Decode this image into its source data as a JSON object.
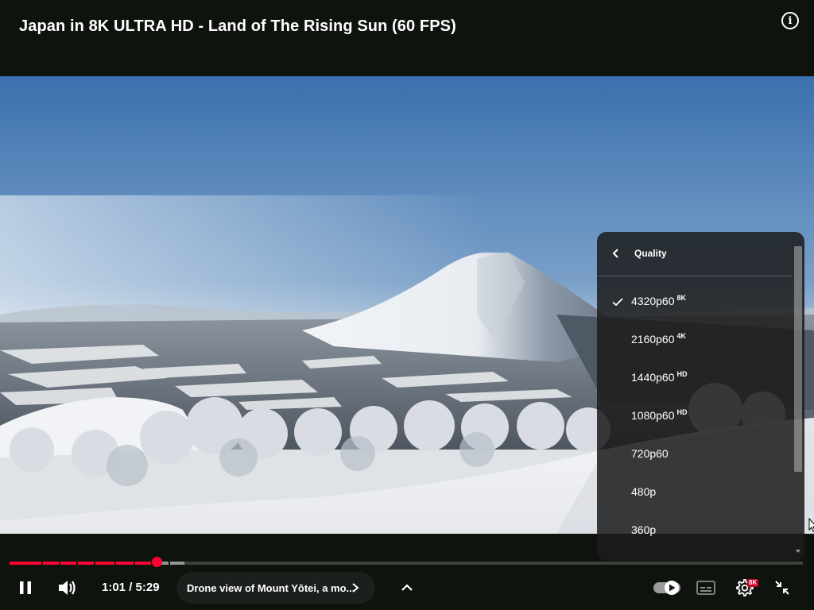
{
  "header": {
    "title": "Japan in 8K ULTRA HD - Land of The Rising Sun (60 FPS)",
    "info_icon": "info-circle-icon"
  },
  "player": {
    "state": "playing",
    "current_time": "1:01",
    "duration": "5:29",
    "time_display": "1:01 / 5:29",
    "progress_fraction": 0.185,
    "buffered_fraction": 0.22,
    "chapter_title": "Drone view of Mount Yōtei, a mo...",
    "colors": {
      "accent": "#ff0033",
      "background": "#0e130e"
    }
  },
  "controls": {
    "play_pause_icon": "pause-icon",
    "volume_icon": "volume-high-icon",
    "expand_icon": "chevron-up-icon",
    "autoplay_icon": "autoplay-toggle-icon",
    "autoplay_on": true,
    "subtitles_icon": "closed-captions-icon",
    "settings_icon": "gear-icon",
    "settings_badge": "8K",
    "fullscreen_icon": "exit-fullscreen-icon"
  },
  "quality_menu": {
    "title": "Quality",
    "back_icon": "chevron-left-icon",
    "items": [
      {
        "label": "4320p60",
        "tag": "8K",
        "selected": true
      },
      {
        "label": "2160p60",
        "tag": "4K",
        "selected": false
      },
      {
        "label": "1440p60",
        "tag": "HD",
        "selected": false
      },
      {
        "label": "1080p60",
        "tag": "HD",
        "selected": false
      },
      {
        "label": "720p60",
        "tag": "",
        "selected": false
      },
      {
        "label": "480p",
        "tag": "",
        "selected": false
      },
      {
        "label": "360p",
        "tag": "",
        "selected": false
      }
    ]
  }
}
